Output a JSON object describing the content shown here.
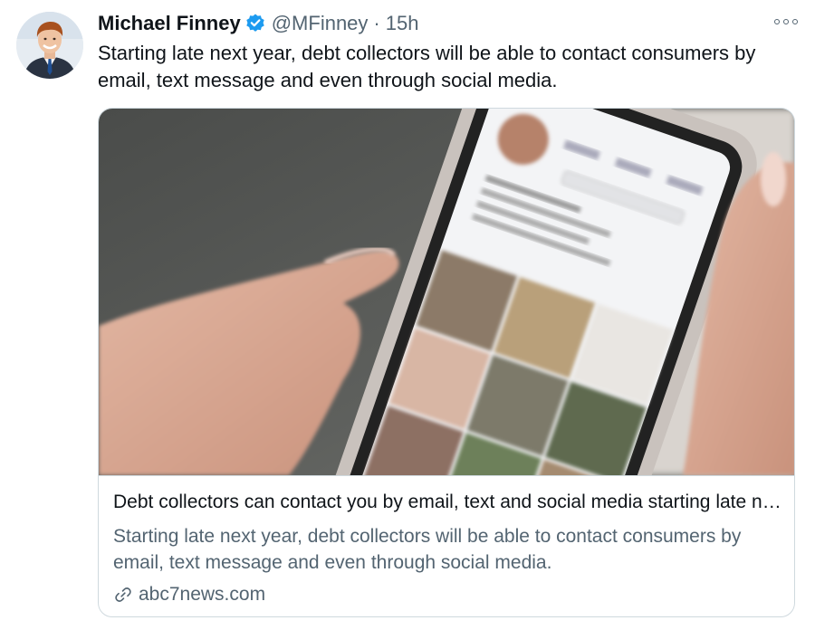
{
  "tweet": {
    "author_name": "Michael Finney",
    "handle": "@MFinney",
    "separator": "·",
    "time": "15h",
    "text": "Starting late next year, debt collectors will be able to contact consumers by email, text message and even through social media.",
    "avatar_icon": "profile-photo",
    "verified_icon": "verified-badge-icon",
    "more_icon": "more-options-icon",
    "verified_color": "#1d9bf0"
  },
  "card": {
    "image_icon": "phone-social-media-photo",
    "title": "Debt collectors can contact you by email, text and social media starting late next year",
    "description": "Starting late next year, debt collectors will be able to contact consumers by email, text message and even through social media.",
    "domain": "abc7news.com",
    "domain_icon": "link-icon"
  }
}
